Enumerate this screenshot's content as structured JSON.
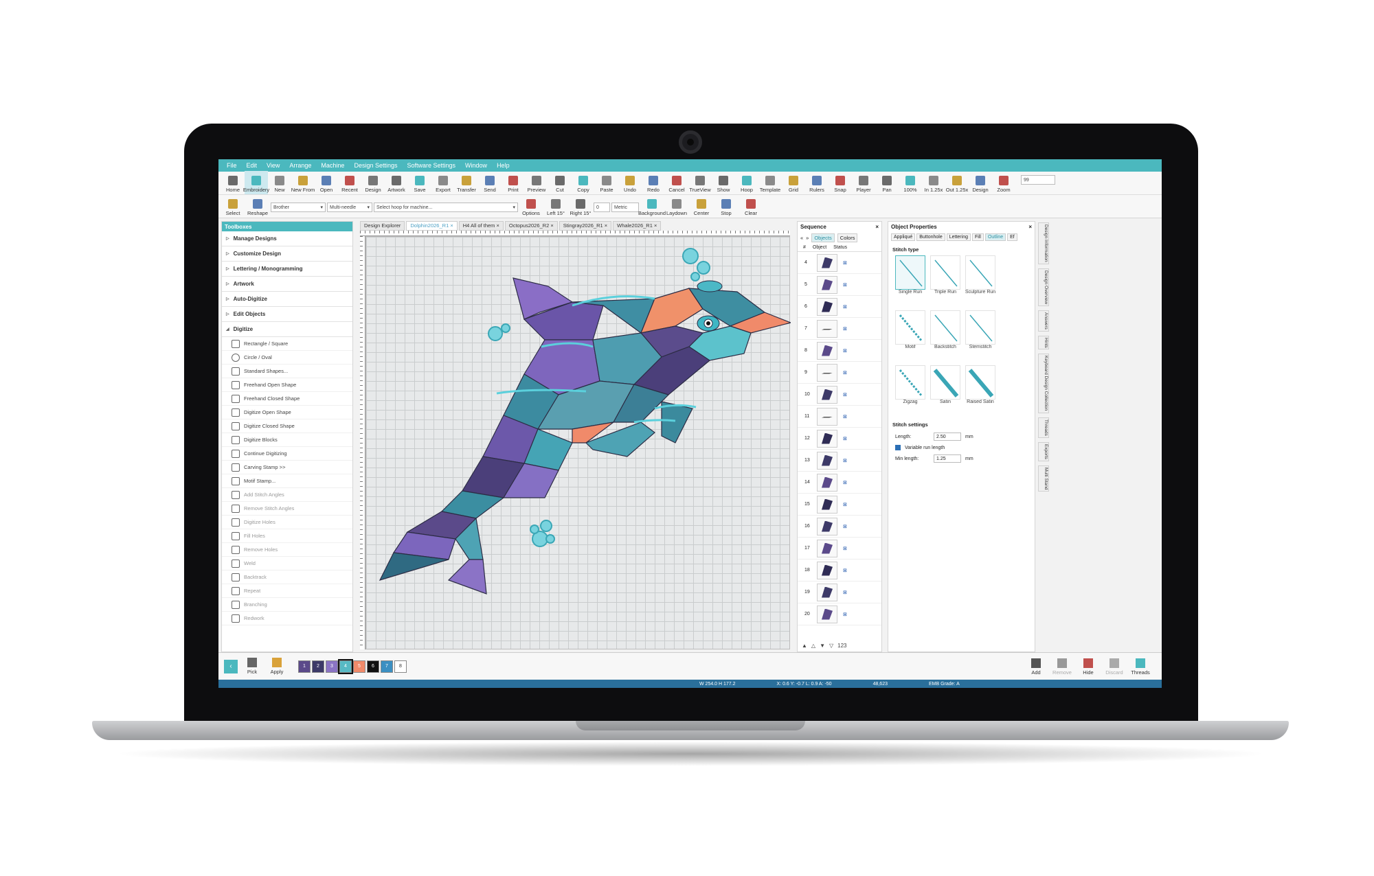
{
  "menu": [
    "File",
    "Edit",
    "View",
    "Arrange",
    "Machine",
    "Design Settings",
    "Software Settings",
    "Window",
    "Help"
  ],
  "ribbon_row1": [
    "Home",
    "Embroidery",
    "New",
    "New From",
    "Open",
    "Recent",
    "Design",
    "Artwork",
    "Save",
    "Export",
    "Transfer",
    "Send",
    "Print",
    "Preview",
    "Cut",
    "Copy",
    "Paste",
    "Undo",
    "Redo",
    "Cancel",
    "TrueView",
    "Show",
    "Hoop",
    "Template",
    "Grid",
    "Rulers",
    "Snap",
    "Player",
    "Pan",
    "100%",
    "In 1.25x",
    "Out 1.25x",
    "Design",
    "Zoom"
  ],
  "zoom_value": "99",
  "ribbon_row2": {
    "buttons": [
      "Select",
      "Reshape",
      "Options",
      "Left 15°",
      "Right 15°",
      "Background",
      "Laydown",
      "Center",
      "Stop",
      "Clear"
    ],
    "machine": "Brother",
    "needle": "Multi-needle",
    "hoop_placeholder": "Select hoop for machine...",
    "rotation": "0",
    "units": "Metric"
  },
  "toolboxes": {
    "title": "Toolboxes",
    "categories": [
      "Manage Designs",
      "Customize Design",
      "Lettering / Monogramming",
      "Artwork",
      "Auto-Digitize",
      "Edit Objects",
      "Digitize"
    ],
    "digitize_items": [
      {
        "label": "Rectangle / Square",
        "dim": false
      },
      {
        "label": "Circle / Oval",
        "dim": false
      },
      {
        "label": "Standard Shapes...",
        "dim": false
      },
      {
        "label": "Freehand Open Shape",
        "dim": false
      },
      {
        "label": "Freehand Closed Shape",
        "dim": false
      },
      {
        "label": "Digitize Open Shape",
        "dim": false
      },
      {
        "label": "Digitize Closed Shape",
        "dim": false
      },
      {
        "label": "Digitize Blocks",
        "dim": false
      },
      {
        "label": "Continue Digitizing",
        "dim": false
      },
      {
        "label": "Carving Stamp >>",
        "dim": false
      },
      {
        "label": "Motif Stamp...",
        "dim": false
      },
      {
        "label": "Add Stitch Angles",
        "dim": true
      },
      {
        "label": "Remove Stitch Angles",
        "dim": true
      },
      {
        "label": "Digitize Holes",
        "dim": true
      },
      {
        "label": "Fill Holes",
        "dim": true
      },
      {
        "label": "Remove Holes",
        "dim": true
      },
      {
        "label": "Weld",
        "dim": true
      },
      {
        "label": "Backtrack",
        "dim": true
      },
      {
        "label": "Repeat",
        "dim": true
      },
      {
        "label": "Branching",
        "dim": true
      },
      {
        "label": "Redwork",
        "dim": true
      }
    ]
  },
  "doc_tabs": [
    "Design Explorer",
    "Dolphin2026_R1",
    "H4 All of them",
    "Octopus2026_R2",
    "Stingray2026_R1",
    "Whale2026_R1"
  ],
  "active_tab": 1,
  "sequence": {
    "title": "Sequence",
    "tabs": [
      "Objects",
      "Colors"
    ],
    "cols": [
      "#",
      "Object",
      "Status"
    ],
    "rows": [
      "4",
      "5",
      "6",
      "7",
      "8",
      "9",
      "10",
      "11",
      "12",
      "13",
      "14",
      "15",
      "16",
      "17",
      "18",
      "19",
      "20"
    ],
    "footer_num": "123"
  },
  "properties": {
    "title": "Object Properties",
    "tabs": [
      "Appliqué",
      "Buttonhole",
      "Lettering",
      "Fill",
      "Outline",
      "Ef"
    ],
    "stitch_type_label": "Stitch type",
    "stitch_types": [
      "Single Run",
      "Triple Run",
      "Sculpture Run",
      "Motif",
      "Backstitch",
      "Stemstitch",
      "Zigzag",
      "Satin",
      "Raised Satin"
    ],
    "settings_label": "Stitch settings",
    "length_label": "Length:",
    "length_value": "2.50",
    "unit": "mm",
    "variable_label": "Variable run length",
    "min_label": "Min length:",
    "min_value": "1.25"
  },
  "side_tabs": [
    "Design Information",
    "Design Overview",
    "Answers",
    "Hints",
    "Keyboard Design Collection",
    "Threads",
    "Exports",
    "Multi Stand"
  ],
  "bottom": {
    "buttons": [
      "Pick",
      "Apply"
    ],
    "swatches": [
      {
        "n": "1",
        "c": "#5b4a8a"
      },
      {
        "n": "2",
        "c": "#3d3a68"
      },
      {
        "n": "3",
        "c": "#8b74c4"
      },
      {
        "n": "4",
        "c": "#57b9c4"
      },
      {
        "n": "5",
        "c": "#f08a6a"
      },
      {
        "n": "6",
        "c": "#111111"
      },
      {
        "n": "7",
        "c": "#3b8fc2"
      },
      {
        "n": "8",
        "c": "#ffffff"
      }
    ],
    "right_buttons": [
      "Add",
      "Remove",
      "Hide",
      "Discard",
      "Threads"
    ]
  },
  "status": [
    "W 254.0 H 177.2",
    "X: 0.6 Y: -0.7 L: 0.9 A: -50",
    "48,623",
    "EMB Grade: A"
  ],
  "colors": {
    "accent": "#4bb8be",
    "status": "#2a6f9b"
  }
}
